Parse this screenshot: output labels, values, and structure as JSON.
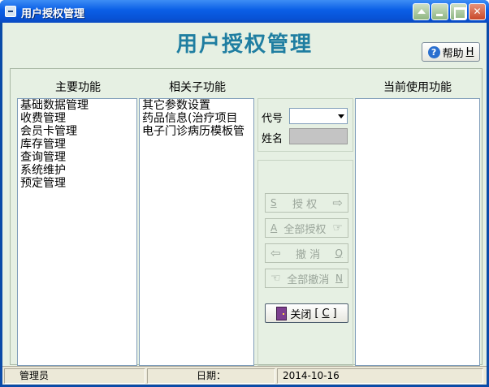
{
  "window": {
    "title": "用户授权管理"
  },
  "header": {
    "title": "用户授权管理",
    "help_label": "帮助",
    "help_key": "H"
  },
  "columns": {
    "main_label": "主要功能",
    "related_label": "相关子功能",
    "current_label": "当前使用功能"
  },
  "main_functions": [
    "基础数据管理",
    "收费管理",
    "会员卡管理",
    "库存管理",
    "查询管理",
    "系统维护",
    "预定管理"
  ],
  "related_functions": [
    "其它参数设置",
    "药品信息(治疗项目",
    "电子门诊病历模板管"
  ],
  "current_functions": [],
  "lookup": {
    "code_label": "代号",
    "code_value": "",
    "name_label": "姓名",
    "name_value": ""
  },
  "actions": {
    "authorize": {
      "key": "S",
      "label": "授 权"
    },
    "authorize_all": {
      "key": "A",
      "label": "全部授权"
    },
    "revoke": {
      "key": "Q",
      "label": "撤 消"
    },
    "revoke_all": {
      "key": "N",
      "label": "全部撤消"
    },
    "close": {
      "label": "关闭",
      "key": "C"
    }
  },
  "status_bar": {
    "user": "管理员",
    "date_label": "日期：",
    "date_value": "2014-10-16"
  },
  "colors": {
    "title_bar": "#0a5ee6",
    "client_bg": "#e6f0e3",
    "header_title": "#1f7ea1",
    "disabled_text": "#9aa59a"
  }
}
